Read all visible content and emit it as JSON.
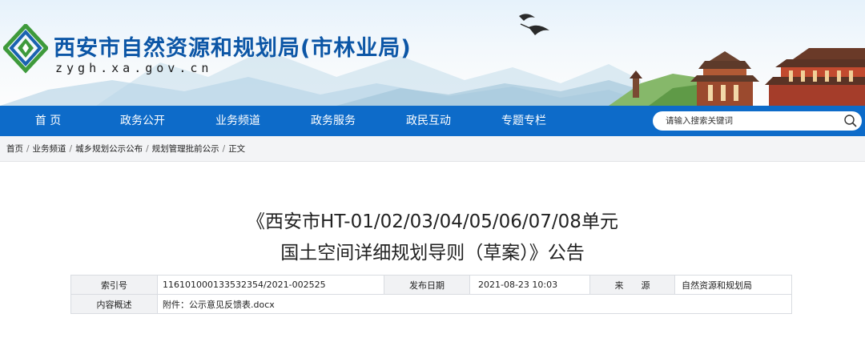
{
  "header": {
    "site_name": "西安市自然资源和规划局(市林业局)",
    "domain": "zygh.xa.gov.cn"
  },
  "nav": {
    "items": [
      {
        "label": "首  页"
      },
      {
        "label": "政务公开"
      },
      {
        "label": "业务频道"
      },
      {
        "label": "政务服务"
      },
      {
        "label": "政民互动"
      },
      {
        "label": "专题专栏"
      }
    ],
    "search_placeholder": "请输入搜索关键词",
    "color": "#0d6bc9"
  },
  "breadcrumb": [
    "首页",
    "业务频道",
    "城乡规划公示公布",
    "规划管理批前公示",
    "正文"
  ],
  "article": {
    "title_line1": "《西安市HT-01/02/03/04/05/06/07/08单元",
    "title_line2": "国土空间详细规划导则（草案）》公告"
  },
  "meta": {
    "index_label": "索引号",
    "index_value": "116101000133532354/2021-002525",
    "date_label": "发布日期",
    "date_value": "2021-08-23 10:03",
    "source_label": "来　　源",
    "source_value": "自然资源和规划局",
    "summary_label": "内容概述",
    "summary_value": "附件：公示意见反馈表.docx"
  },
  "colors": {
    "brand_blue": "#0c56a6",
    "nav_blue": "#0d6bc9",
    "logo_green": "#3e9a3b"
  }
}
